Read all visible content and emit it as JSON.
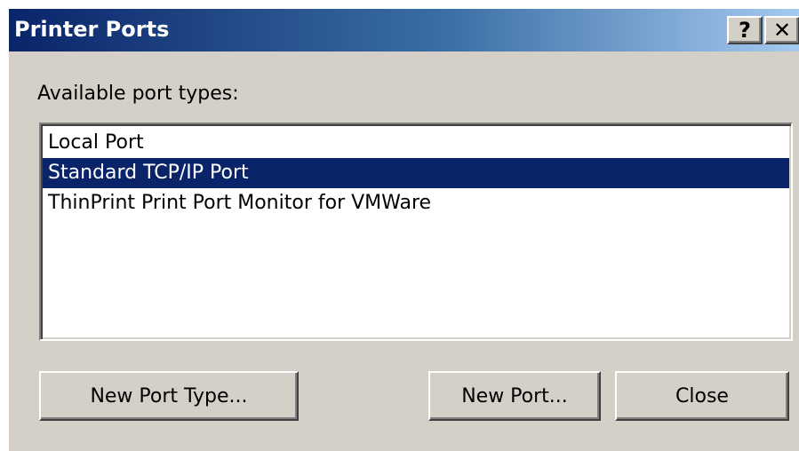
{
  "window": {
    "title": "Printer Ports",
    "help_label": "?",
    "close_label": "✕"
  },
  "dialog": {
    "label": "Available port types:",
    "port_types": [
      {
        "label": "Local Port",
        "selected": false
      },
      {
        "label": "Standard TCP/IP Port",
        "selected": true
      },
      {
        "label": "ThinPrint Print Port Monitor for VMWare",
        "selected": false
      }
    ]
  },
  "buttons": {
    "new_port_type": "New Port Type...",
    "new_port": "New Port...",
    "close": "Close"
  },
  "colors": {
    "title_gradient_start": "#0a246a",
    "title_gradient_end": "#a6caf0",
    "dialog_bg": "#d4d0c8",
    "selection_bg": "#0a246a"
  }
}
